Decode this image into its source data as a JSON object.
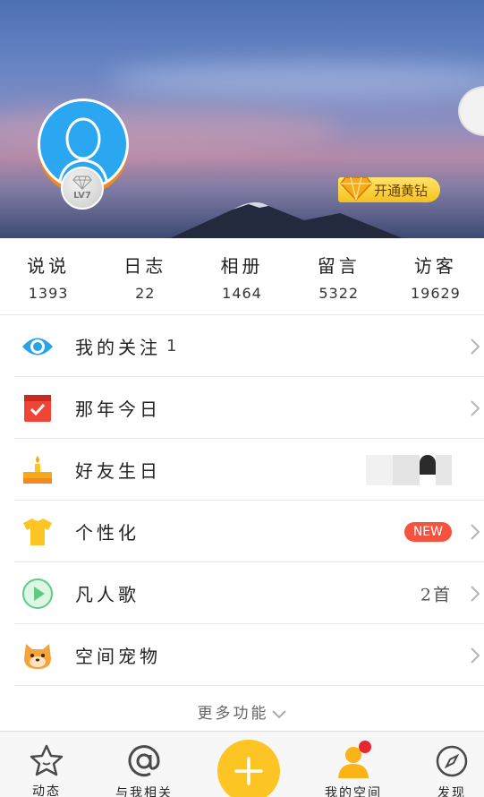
{
  "cover": {
    "level_label": "LV7",
    "vip_button_label": "开通黄钻"
  },
  "stats": [
    {
      "label": "说说",
      "value": "1393"
    },
    {
      "label": "日志",
      "value": "22"
    },
    {
      "label": "相册",
      "value": "1464"
    },
    {
      "label": "留言",
      "value": "5322"
    },
    {
      "label": "访客",
      "value": "19629"
    }
  ],
  "menu": [
    {
      "label": "我的关注",
      "count": "1",
      "icon": "eye-icon"
    },
    {
      "label": "那年今日",
      "icon": "calendar-check-icon"
    },
    {
      "label": "好友生日",
      "icon": "birthday-cake-icon"
    },
    {
      "label": "个性化",
      "badge": "NEW",
      "icon": "tshirt-icon"
    },
    {
      "label": "凡人歌",
      "extra": "2首",
      "icon": "play-icon"
    },
    {
      "label": "空间宠物",
      "icon": "pet-icon"
    }
  ],
  "more_label": "更多功能",
  "tabs": [
    {
      "label": "动态",
      "icon": "star-icon"
    },
    {
      "label": "与我相关",
      "icon": "at-icon"
    },
    {
      "label": "",
      "icon": "plus-icon"
    },
    {
      "label": "我的空间",
      "icon": "person-icon"
    },
    {
      "label": "发现",
      "icon": "compass-icon"
    }
  ],
  "colors": {
    "accent_yellow": "#fcc524",
    "badge_red": "#f5523f",
    "avatar_blue": "#2aa7f0"
  }
}
